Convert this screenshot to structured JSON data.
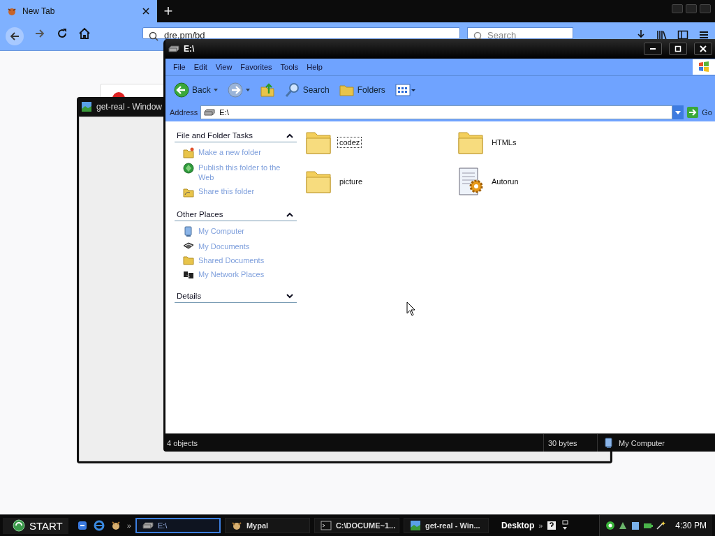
{
  "browser": {
    "tabs": [
      {
        "title": "New Tab",
        "selected": true
      }
    ],
    "new_tab_button": "+",
    "address": "dre.pm/bd",
    "search_placeholder": "Search"
  },
  "background_window": {
    "title": "get-real - Window"
  },
  "explorer": {
    "title": "E:\\",
    "menu": [
      "File",
      "Edit",
      "View",
      "Favorites",
      "Tools",
      "Help"
    ],
    "toolbar": [
      {
        "kind": "back",
        "label": "Back"
      },
      {
        "kind": "forward"
      },
      {
        "kind": "up"
      },
      {
        "kind": "search",
        "label": "Search"
      },
      {
        "kind": "folders",
        "label": "Folders"
      },
      {
        "kind": "views"
      }
    ],
    "address_label": "Address",
    "address": "E:\\",
    "go": "Go",
    "panels": [
      {
        "title": "File and Folder Tasks",
        "expanded": true,
        "items": [
          {
            "kind": "new-folder",
            "label": "Make a new folder"
          },
          {
            "kind": "globe",
            "label": "Publish this folder to the Web"
          },
          {
            "kind": "share",
            "label": "Share this folder"
          }
        ]
      },
      {
        "title": "Other Places",
        "expanded": true,
        "items": [
          {
            "kind": "computer",
            "label": "My Computer"
          },
          {
            "kind": "documents",
            "label": "My Documents"
          },
          {
            "kind": "folder",
            "label": "Shared Documents"
          },
          {
            "kind": "network",
            "label": "My Network Places"
          }
        ]
      },
      {
        "title": "Details",
        "expanded": false
      }
    ],
    "items": [
      {
        "name": "codez",
        "kind": "folder",
        "selected": true
      },
      {
        "name": "HTMLs",
        "kind": "folder",
        "selected": false
      },
      {
        "name": "picture",
        "kind": "folder",
        "selected": false
      },
      {
        "name": "Autorun",
        "kind": "settings-file",
        "selected": false
      }
    ],
    "status": {
      "objects": "4 objects",
      "size": "30 bytes",
      "zone": "My Computer"
    }
  },
  "taskbar": {
    "start": "START",
    "tasks": [
      {
        "label": "E:\\",
        "kind": "drive",
        "selected": true
      },
      {
        "label": "Mypal",
        "kind": "app",
        "selected": false
      },
      {
        "label": "C:\\DOCUME~1...",
        "kind": "console",
        "selected": false
      },
      {
        "label": "get-real - Win...",
        "kind": "image",
        "selected": false
      }
    ],
    "toolbar": "Desktop",
    "overflow": "»",
    "clock": "4:30 PM"
  }
}
